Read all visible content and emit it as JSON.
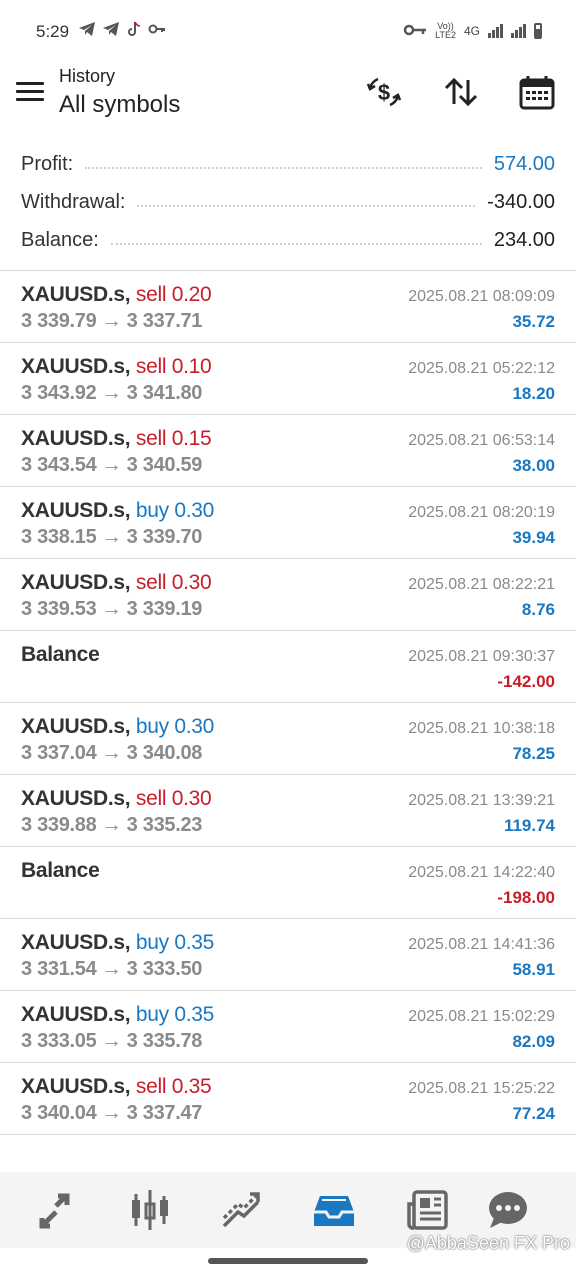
{
  "status_bar": {
    "time": "5:29",
    "net_label": "4G",
    "volte_label": "Vo))\nLTE2"
  },
  "header": {
    "subtitle": "History",
    "title": "All symbols"
  },
  "summary": {
    "profit_label": "Profit:",
    "profit_value": "574.00",
    "withdrawal_label": "Withdrawal:",
    "withdrawal_value": "-340.00",
    "balance_label": "Balance:",
    "balance_value": "234.00"
  },
  "trades": [
    {
      "symbol": "XAUUSD.s,",
      "direction": "sell",
      "volume": "sell 0.20",
      "prices": "3 339.79 → 3 337.71",
      "time": "2025.08.21 08:09:09",
      "profit": "35.72",
      "sign": "pos"
    },
    {
      "symbol": "XAUUSD.s,",
      "direction": "sell",
      "volume": "sell 0.10",
      "prices": "3 343.92 → 3 341.80",
      "time": "2025.08.21 05:22:12",
      "profit": "18.20",
      "sign": "pos"
    },
    {
      "symbol": "XAUUSD.s,",
      "direction": "sell",
      "volume": "sell 0.15",
      "prices": "3 343.54 → 3 340.59",
      "time": "2025.08.21 06:53:14",
      "profit": "38.00",
      "sign": "pos"
    },
    {
      "symbol": "XAUUSD.s,",
      "direction": "buy",
      "volume": "buy 0.30",
      "prices": "3 338.15 → 3 339.70",
      "time": "2025.08.21 08:20:19",
      "profit": "39.94",
      "sign": "pos"
    },
    {
      "symbol": "XAUUSD.s,",
      "direction": "sell",
      "volume": "sell 0.30",
      "prices": "3 339.53 → 3 339.19",
      "time": "2025.08.21 08:22:21",
      "profit": "8.76",
      "sign": "pos"
    },
    {
      "symbol": "Balance",
      "direction": "",
      "volume": "",
      "prices": "",
      "time": "2025.08.21 09:30:37",
      "profit": "-142.00",
      "sign": "neg"
    },
    {
      "symbol": "XAUUSD.s,",
      "direction": "buy",
      "volume": "buy 0.30",
      "prices": "3 337.04 → 3 340.08",
      "time": "2025.08.21 10:38:18",
      "profit": "78.25",
      "sign": "pos"
    },
    {
      "symbol": "XAUUSD.s,",
      "direction": "sell",
      "volume": "sell 0.30",
      "prices": "3 339.88 → 3 335.23",
      "time": "2025.08.21 13:39:21",
      "profit": "119.74",
      "sign": "pos"
    },
    {
      "symbol": "Balance",
      "direction": "",
      "volume": "",
      "prices": "",
      "time": "2025.08.21 14:22:40",
      "profit": "-198.00",
      "sign": "neg"
    },
    {
      "symbol": "XAUUSD.s,",
      "direction": "buy",
      "volume": "buy 0.35",
      "prices": "3 331.54 → 3 333.50",
      "time": "2025.08.21 14:41:36",
      "profit": "58.91",
      "sign": "pos"
    },
    {
      "symbol": "XAUUSD.s,",
      "direction": "buy",
      "volume": "buy 0.35",
      "prices": "3 333.05 → 3 335.78",
      "time": "2025.08.21 15:02:29",
      "profit": "82.09",
      "sign": "pos"
    },
    {
      "symbol": "XAUUSD.s,",
      "direction": "sell",
      "volume": "sell 0.35",
      "prices": "3 340.04 → 3 337.47",
      "time": "2025.08.21 15:25:22",
      "profit": "77.24",
      "sign": "pos"
    }
  ],
  "bottom_nav": [
    {
      "name": "quotes",
      "icon": "quotes-arrows-icon"
    },
    {
      "name": "chart",
      "icon": "candlestick-chart-icon"
    },
    {
      "name": "trade",
      "icon": "trade-line-icon"
    },
    {
      "name": "history",
      "icon": "inbox-history-icon",
      "active": true
    },
    {
      "name": "news",
      "icon": "newspaper-icon"
    },
    {
      "name": "messages",
      "icon": "chat-bubble-icon"
    }
  ],
  "watermark": "@AbbaSeen FX Pro",
  "colors": {
    "accent": "#1a78c2",
    "negative": "#c81e28",
    "muted": "#8a8a8a"
  }
}
